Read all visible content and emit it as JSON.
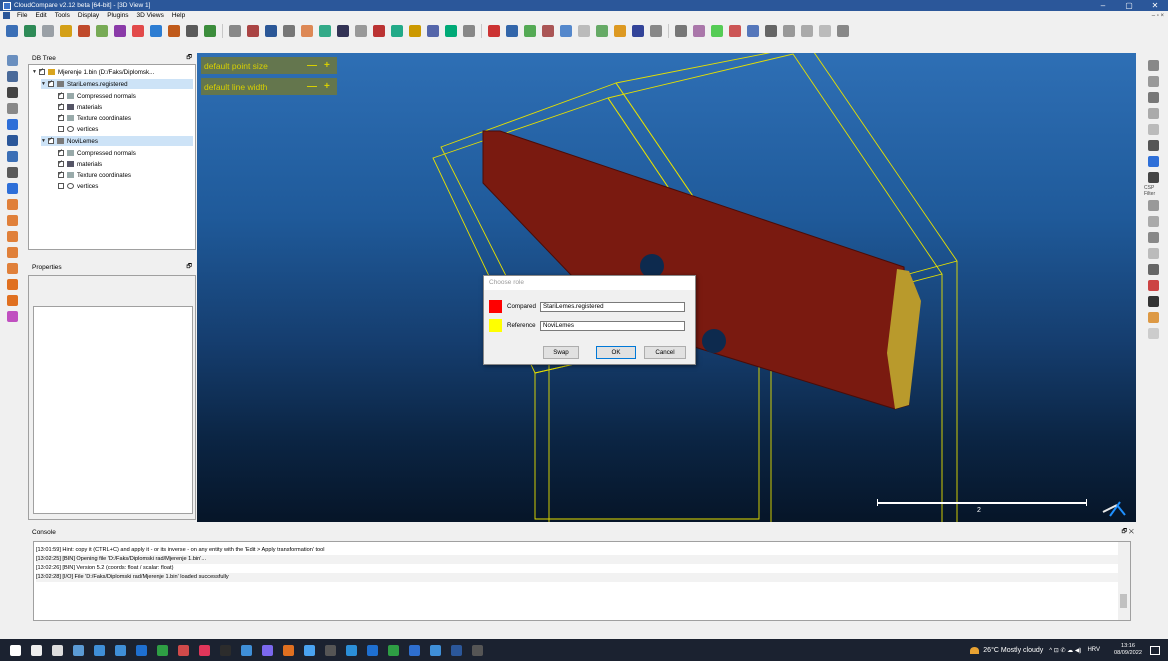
{
  "window": {
    "title": "CloudCompare v2.12 beta [64-bit] - [3D View 1]",
    "minimize": "–",
    "maximize": "▢",
    "close": "✕"
  },
  "menu": {
    "items": [
      "File",
      "Edit",
      "Tools",
      "Display",
      "Plugins",
      "3D Views",
      "Help"
    ],
    "doc_controls": "– ▫ ×"
  },
  "db_tree": {
    "title": "DB Tree",
    "float_icon": "🗗",
    "rows": [
      {
        "label": "Mjerenje 1.bin (D:/Faks/Diplomsk...",
        "icon": "folder-icon"
      },
      {
        "label": "StariLemes.registered",
        "icon": "mesh-icon"
      },
      {
        "label": "Compressed normals",
        "icon": "normals-icon"
      },
      {
        "label": "materials",
        "icon": "materials-icon"
      },
      {
        "label": "Texture coordinates",
        "icon": "texture-icon"
      },
      {
        "label": "vertices",
        "icon": "cloud-icon"
      },
      {
        "label": "NoviLemes",
        "icon": "mesh-icon"
      },
      {
        "label": "Compressed normals",
        "icon": "normals-icon"
      },
      {
        "label": "materials",
        "icon": "materials-icon"
      },
      {
        "label": "Texture coordinates",
        "icon": "texture-icon"
      },
      {
        "label": "vertices",
        "icon": "cloud-icon"
      }
    ]
  },
  "properties": {
    "title": "Properties",
    "float_icon": "🗗"
  },
  "view": {
    "point_size_label": "default point size",
    "line_width_label": "default line width",
    "minus": "—",
    "plus": "+",
    "scale_label": "2"
  },
  "dialog": {
    "title": "Choose role",
    "compared_label": "Compared",
    "compared_value": "StariLemes.registered",
    "compared_color": "#ff0000",
    "reference_label": "Reference",
    "reference_value": "NoviLemes",
    "reference_color": "#ffff00",
    "swap": "Swap",
    "ok": "OK",
    "cancel": "Cancel"
  },
  "console": {
    "title": "Console",
    "controls": "🗗 ✕",
    "lines": [
      "[13:01:59] Hint: copy it (CTRL+C) and apply it - or its inverse - on any entity with the 'Edit > Apply transformation' tool",
      "[13:02:25] [BIN] Opening file 'D:/Faks/Diplomski rad/Mjerenje 1.bin'...",
      "[13:02:26] [BIN] Version 5.2 (coords: float / scalar: float)",
      "[13:02:28] [I/O] File 'D:/Faks/Diplomski rad/Mjerenje 1.bin' loaded successfully"
    ]
  },
  "taskbar": {
    "weather": "26°C Mostly cloudy",
    "lang": "HRV",
    "time": "13:16",
    "date": "08/09/2022",
    "tray_icons": "^ ⊡ ✆ ☁ ◀)"
  },
  "right_toolbar": {
    "csp_label": "CSP Filter"
  }
}
